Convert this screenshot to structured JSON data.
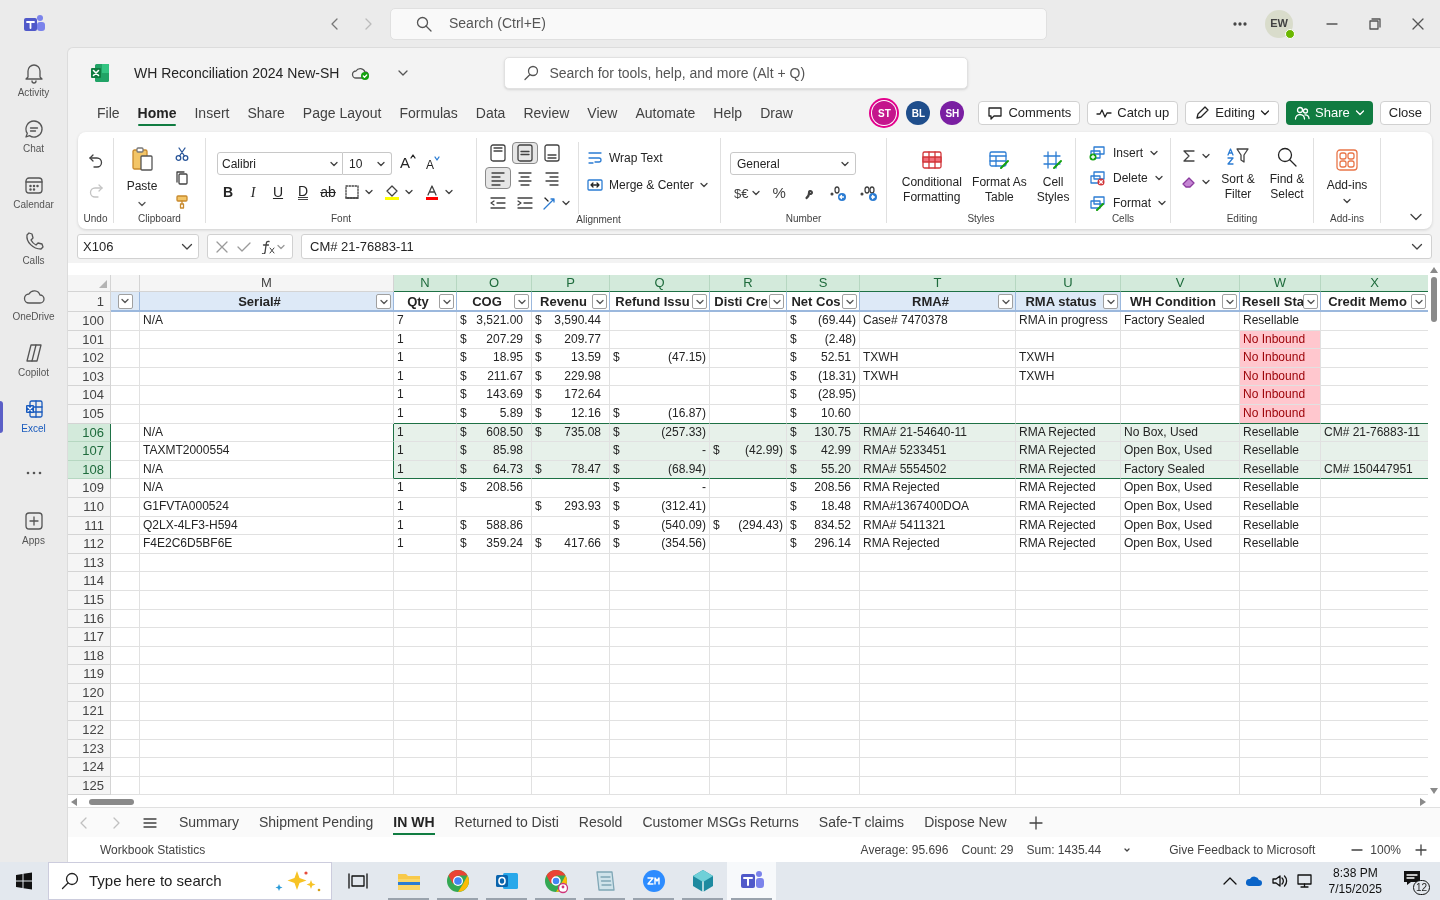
{
  "teams": {
    "search_placeholder": "Search (Ctrl+E)",
    "avatar": "EW",
    "rail": [
      {
        "kind": "bell",
        "label": "Activity",
        "selected": false
      },
      {
        "kind": "chat",
        "label": "Chat",
        "selected": false
      },
      {
        "kind": "calendar",
        "label": "Calendar",
        "selected": false
      },
      {
        "kind": "phone",
        "label": "Calls",
        "selected": false
      },
      {
        "kind": "cloud",
        "label": "OneDrive",
        "selected": false
      },
      {
        "kind": "copilot",
        "label": "Copilot",
        "selected": false
      },
      {
        "kind": "excel",
        "label": "Excel",
        "selected": true
      },
      {
        "kind": "more",
        "selected": false
      },
      {
        "kind": "apps",
        "label": "Apps",
        "selected": false
      }
    ]
  },
  "workbook": {
    "title": "WH Reconciliation 2024 New-SH",
    "search_placeholder": "Search for tools, help, and more (Alt + Q)"
  },
  "menu_tabs": [
    {
      "label": "File",
      "selected": false
    },
    {
      "label": "Home",
      "selected": true
    },
    {
      "label": "Insert",
      "selected": false
    },
    {
      "label": "Share",
      "selected": false
    },
    {
      "label": "Page Layout",
      "selected": false
    },
    {
      "label": "Formulas",
      "selected": false
    },
    {
      "label": "Data",
      "selected": false
    },
    {
      "label": "Review",
      "selected": false
    },
    {
      "label": "View",
      "selected": false
    },
    {
      "label": "Automate",
      "selected": false
    },
    {
      "label": "Help",
      "selected": false
    },
    {
      "label": "Draw",
      "selected": false
    }
  ],
  "collaborators": [
    {
      "initials": "ST",
      "color": "#c4158c"
    },
    {
      "initials": "BL",
      "color": "#1f4e8c"
    },
    {
      "initials": "SH",
      "color": "#7a1fa2"
    }
  ],
  "actions": [
    {
      "kind": "comments",
      "label": "Comments"
    },
    {
      "kind": "catchup",
      "label": "Catch up"
    },
    {
      "kind": "editing",
      "label": "Editing"
    },
    {
      "kind": "share",
      "label": "Share"
    },
    {
      "kind": "close",
      "label": "Close"
    }
  ],
  "ribbon": [
    {
      "kind": "undo",
      "label": "Undo",
      "redo_disabled": true
    },
    {
      "kind": "clipboard",
      "label": "Clipboard",
      "buttons": [
        "Paste"
      ]
    },
    {
      "kind": "font",
      "label": "Font",
      "font": "Calibri",
      "size": "10",
      "size_buttons": [
        "A",
        "A"
      ],
      "format_buttons": [
        "B",
        "I",
        "U",
        "D",
        "ab"
      ]
    },
    {
      "kind": "alignment",
      "label": "Alignment",
      "align_buttons": [
        {
          "kind": "top",
          "selected": false
        },
        {
          "kind": "middle",
          "selected": true
        },
        {
          "kind": "bottom",
          "selected": false
        },
        {
          "kind": "left",
          "selected": true
        },
        {
          "kind": "center",
          "selected": false
        },
        {
          "kind": "right",
          "selected": false
        }
      ],
      "buttons": [
        "Wrap Text",
        "Merge & Center"
      ]
    },
    {
      "kind": "number",
      "label": "Number",
      "format": "General",
      "buttons": [
        "$€",
        "%"
      ]
    },
    {
      "kind": "styles",
      "label": "Styles",
      "buttons": [
        "Conditional Formatting",
        "Format As Table",
        "Cell Styles"
      ]
    },
    {
      "kind": "cells",
      "label": "Cells",
      "buttons": [
        "Insert",
        "Delete",
        "Format"
      ]
    },
    {
      "kind": "editing",
      "label": "Editing",
      "buttons": [
        "Sort & Filter",
        "Find & Select"
      ]
    },
    {
      "kind": "addins",
      "label": "Add-ins",
      "buttons": [
        "Add-ins"
      ]
    }
  ],
  "name_box": "X106",
  "formula": "CM# 21-76883-11",
  "sheet": {
    "columns": [
      {
        "letter": "M",
        "header": "Serial#",
        "kind": "text",
        "color": "#dde9f7",
        "selected": false
      },
      {
        "letter": "N",
        "header": "Qty",
        "kind": "text",
        "color": "#ffffff",
        "selected": true
      },
      {
        "letter": "O",
        "header": "COG",
        "kind": "accounting",
        "color": "#ffffff",
        "selected": true
      },
      {
        "letter": "P",
        "header": "Revenu",
        "kind": "accounting",
        "color": "#ffffff",
        "selected": true
      },
      {
        "letter": "Q",
        "header": "Refund Issu",
        "kind": "accounting",
        "color": "#ffffff",
        "selected": true
      },
      {
        "letter": "R",
        "header": "Disti Cre",
        "kind": "accounting",
        "color": "#ffffff",
        "selected": true
      },
      {
        "letter": "S",
        "header": "Net Cos",
        "kind": "accounting",
        "color": "#ffffff",
        "selected": true
      },
      {
        "letter": "T",
        "header": "RMA#",
        "kind": "text",
        "color": "#dde9f7",
        "selected": true
      },
      {
        "letter": "U",
        "header": "RMA status",
        "kind": "text",
        "color": "#dde9f7",
        "selected": true
      },
      {
        "letter": "V",
        "header": "WH Condition",
        "kind": "text",
        "color": "#ffffff",
        "selected": true
      },
      {
        "letter": "W",
        "header": "Resell Sta",
        "kind": "status",
        "color": "#ffffff",
        "selected": true
      },
      {
        "letter": "X",
        "header": "Credit Memo",
        "kind": "text",
        "color": "#ffffff",
        "selected": true
      }
    ],
    "currency": "$",
    "header_row_number": "1",
    "rows": [
      {
        "number": "100",
        "selected": false,
        "resell_highlight": false,
        "cells": [
          "N/A",
          "7",
          "3,521.00",
          "3,590.44",
          null,
          null,
          "(69.44)",
          "Case# 7470378",
          "RMA in progress",
          "Factory Sealed",
          "Resellable",
          null
        ]
      },
      {
        "number": "101",
        "selected": false,
        "resell_highlight": true,
        "cells": [
          null,
          "1",
          "207.29",
          "209.77",
          null,
          null,
          "(2.48)",
          null,
          null,
          null,
          "No Inbound",
          null
        ]
      },
      {
        "number": "102",
        "selected": false,
        "resell_highlight": true,
        "cells": [
          null,
          "1",
          "18.95",
          "13.59",
          "(47.15)",
          null,
          "52.51",
          "TXWH",
          "TXWH",
          null,
          "No Inbound",
          null
        ]
      },
      {
        "number": "103",
        "selected": false,
        "resell_highlight": true,
        "cells": [
          null,
          "1",
          "211.67",
          "229.98",
          null,
          null,
          "(18.31)",
          "TXWH",
          "TXWH",
          null,
          "No Inbound",
          null
        ]
      },
      {
        "number": "104",
        "selected": false,
        "resell_highlight": true,
        "cells": [
          null,
          "1",
          "143.69",
          "172.64",
          null,
          null,
          "(28.95)",
          null,
          null,
          null,
          "No Inbound",
          null
        ]
      },
      {
        "number": "105",
        "selected": false,
        "resell_highlight": true,
        "cells": [
          null,
          "1",
          "5.89",
          "12.16",
          "(16.87)",
          null,
          "10.60",
          null,
          null,
          null,
          "No Inbound",
          null
        ]
      },
      {
        "number": "106",
        "selected": true,
        "resell_highlight": false,
        "cells": [
          "N/A",
          "1",
          "608.50",
          "735.08",
          "(257.33)",
          null,
          "130.75",
          "RMA# 21-54640-11",
          "RMA Rejected",
          "No Box, Used",
          "Resellable",
          "CM# 21-76883-11"
        ]
      },
      {
        "number": "107",
        "selected": true,
        "resell_highlight": false,
        "cells": [
          "TAXMT2000554",
          "1",
          "85.98",
          null,
          "-",
          "(42.99)",
          "42.99",
          "RMA# 5233451",
          "RMA Rejected",
          "Open Box, Used",
          "Resellable",
          null
        ]
      },
      {
        "number": "108",
        "selected": true,
        "resell_highlight": false,
        "cells": [
          "N/A",
          "1",
          "64.73",
          "78.47",
          "(68.94)",
          null,
          "55.20",
          "RMA# 5554502",
          "RMA Rejected",
          "Factory Sealed",
          "Resellable",
          "CM# 150447951"
        ]
      },
      {
        "number": "109",
        "selected": false,
        "resell_highlight": false,
        "cells": [
          "N/A",
          "1",
          "208.56",
          null,
          "-",
          null,
          "208.56",
          "RMA Rejected",
          "RMA Rejected",
          "Open Box, Used",
          "Resellable",
          null
        ]
      },
      {
        "number": "110",
        "selected": false,
        "resell_highlight": false,
        "cells": [
          "G1FVTA000524",
          "1",
          null,
          "293.93",
          "(312.41)",
          null,
          "18.48",
          "RMA#1367400DOA",
          "RMA Rejected",
          "Open Box, Used",
          "Resellable",
          null
        ]
      },
      {
        "number": "111",
        "selected": false,
        "resell_highlight": false,
        "cells": [
          "Q2LX-4LF3-H594",
          "1",
          "588.86",
          null,
          "(540.09)",
          "(294.43)",
          "834.52",
          "RMA# 5411321",
          "RMA Rejected",
          "Open Box, Used",
          "Resellable",
          null
        ]
      },
      {
        "number": "112",
        "selected": false,
        "resell_highlight": false,
        "cells": [
          "F4E2C6D5BF6E",
          "1",
          "359.24",
          "417.66",
          "(354.56)",
          null,
          "296.14",
          "RMA Rejected",
          "RMA Rejected",
          "Open Box, Used",
          "Resellable",
          null
        ]
      },
      {
        "number": "113",
        "selected": false
      },
      {
        "number": "114",
        "selected": false
      },
      {
        "number": "115",
        "selected": false
      },
      {
        "number": "116",
        "selected": false
      },
      {
        "number": "117",
        "selected": false
      },
      {
        "number": "118",
        "selected": false
      },
      {
        "number": "119",
        "selected": false
      },
      {
        "number": "120",
        "selected": false
      },
      {
        "number": "121",
        "selected": false
      },
      {
        "number": "122",
        "selected": false
      },
      {
        "number": "123",
        "selected": false
      },
      {
        "number": "124",
        "selected": false
      },
      {
        "number": "125",
        "selected": false
      }
    ]
  },
  "sheet_tabs": [
    {
      "label": "Summary",
      "selected": false
    },
    {
      "label": "Shipment Pending",
      "selected": false
    },
    {
      "label": "IN WH",
      "selected": true
    },
    {
      "label": "Returned to Disti",
      "selected": false
    },
    {
      "label": "Resold",
      "selected": false
    },
    {
      "label": "Customer MSGs Returns",
      "selected": false
    },
    {
      "label": "Safe-T claims",
      "selected": false
    },
    {
      "label": "Dispose New",
      "selected": false
    }
  ],
  "status_bar": {
    "left": "Workbook Statistics",
    "average": "Average: 95.696",
    "count": "Count: 29",
    "sum": "Sum: 1435.44",
    "feedback": "Give Feedback to Microsoft",
    "zoom": "100%"
  },
  "taskbar": {
    "search_placeholder": "Type here to search",
    "time": "8:38 PM",
    "date": "7/15/2025",
    "notifications": "12"
  }
}
